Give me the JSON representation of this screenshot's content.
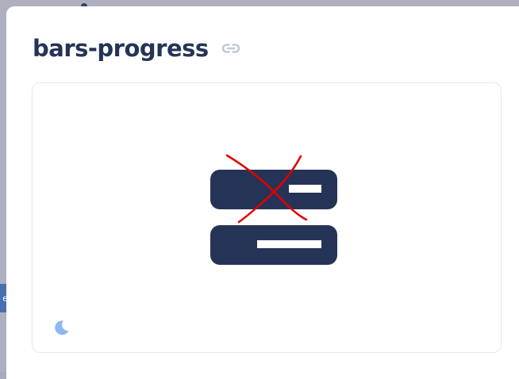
{
  "header": {
    "title": "bars-progress",
    "link_icon": "link-icon"
  },
  "preview": {
    "icon": "bars-progress-icon",
    "icon_color": "#253456",
    "strike_color": "#e00000",
    "theme_toggle_icon": "moon-icon",
    "theme_toggle_color": "#8fb6f5"
  },
  "backdrop": {
    "strip_text": "e"
  }
}
